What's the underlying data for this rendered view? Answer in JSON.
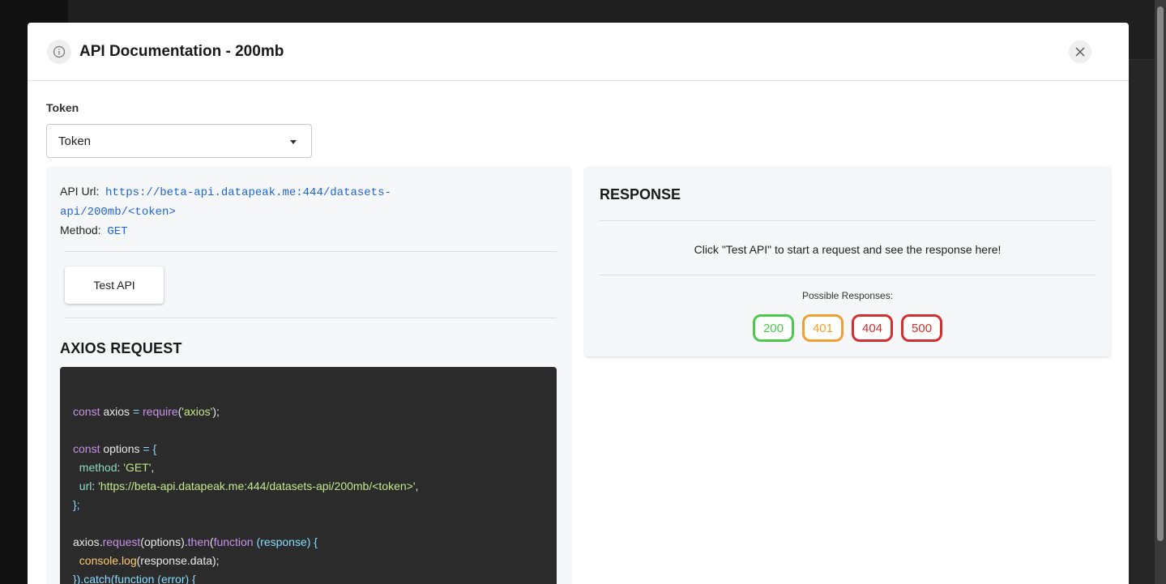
{
  "modal": {
    "title": "API Documentation - 200mb"
  },
  "token": {
    "label": "Token",
    "selected": "Token"
  },
  "api": {
    "url_label": "API Url:",
    "url_line1": "https://beta-api.datapeak.me:444/datasets-",
    "url_line2": "api/200mb/<token>",
    "method_label": "Method:",
    "method": "GET"
  },
  "test_button": "Test API",
  "axios": {
    "title": "AXIOS REQUEST",
    "code": {
      "l1_kw": "const",
      "l1_var": " axios ",
      "l1_eq": "= ",
      "l1_fn": "require",
      "l1_p1": "(",
      "l1_str": "'axios'",
      "l1_p2": ");",
      "l2_kw": "const",
      "l2_var": " options ",
      "l2_eq": "= {",
      "l3_prop": "  method",
      "l3_colon": ": ",
      "l3_str": "'GET'",
      "l3_comma": ",",
      "l4_prop": "  url",
      "l4_colon": ": ",
      "l4_str": "'https://beta-api.datapeak.me:444/datasets-api/200mb/<token>'",
      "l4_comma": ",",
      "l5": "};",
      "l6_obj": "axios",
      "l6_dot": ".",
      "l6_fn": "request",
      "l6_a": "(options).",
      "l6_then": "then",
      "l6_b": "(",
      "l6_func": "function",
      "l6_c": " (response) {",
      "l7_obj": "  console",
      "l7_dot": ".",
      "l7_fn": "log",
      "l7_rest": "(response.data);",
      "l8": "}).catch(function (error) {"
    }
  },
  "response": {
    "title": "RESPONSE",
    "message": "Click \"Test API\" to start a request and see the response here!",
    "possible_label": "Possible Responses:",
    "codes": [
      {
        "code": "200",
        "color": "#4cc94c"
      },
      {
        "code": "401",
        "color": "#f0a033"
      },
      {
        "code": "404",
        "color": "#d32f2f"
      },
      {
        "code": "500",
        "color": "#d32f2f"
      }
    ]
  }
}
